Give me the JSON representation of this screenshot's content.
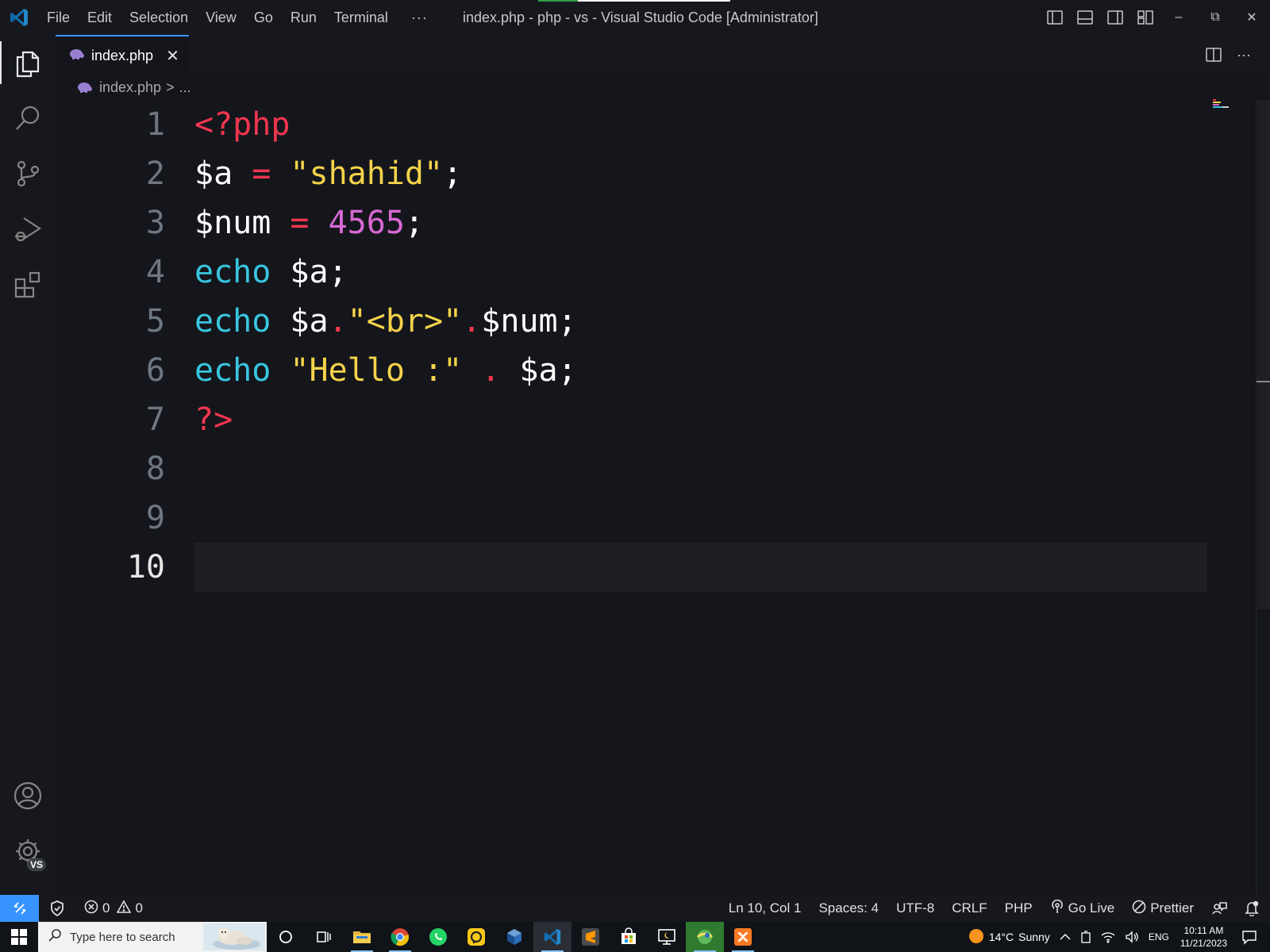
{
  "window": {
    "title": "index.php - php - vs - Visual Studio Code [Administrator]",
    "menu": [
      "File",
      "Edit",
      "Selection",
      "View",
      "Go",
      "Run",
      "Terminal"
    ],
    "menu_more": "···",
    "minimize": "–",
    "restore": "⧉",
    "close": "✕"
  },
  "activity": {
    "account_badge": "VS"
  },
  "tab": {
    "label": "index.php",
    "close": "✕",
    "more": "···"
  },
  "breadcrumb": {
    "file": "index.php",
    "separator": ">",
    "tail": "..."
  },
  "editor": {
    "current_line": 10,
    "lines": [
      {
        "number": "1"
      },
      {
        "number": "2"
      },
      {
        "number": "3"
      },
      {
        "number": "4"
      },
      {
        "number": "5"
      },
      {
        "number": "6"
      },
      {
        "number": "7"
      },
      {
        "number": "8"
      },
      {
        "number": "9"
      },
      {
        "number": "10"
      }
    ],
    "tokens": {
      "l1": [
        "<?php"
      ],
      "l2": [
        "$a",
        " = ",
        "\"shahid\"",
        ";"
      ],
      "l3": [
        "$num",
        " = ",
        "4565",
        ";"
      ],
      "l4": [
        "echo",
        " $a",
        ";"
      ],
      "l5": [
        "echo",
        " $a",
        ".",
        "\"<br>\"",
        ".",
        "$num",
        ";"
      ],
      "l6": [
        "echo",
        " \"Hello :\"",
        " . ",
        "$a",
        ";"
      ],
      "l7": [
        "?>"
      ]
    },
    "colors": {
      "tag": "#f2364f",
      "string": "#f5d34a",
      "number": "#d869d5",
      "keyword": "#39c5e0"
    }
  },
  "status": {
    "errors": "0",
    "warnings": "0",
    "position": "Ln 10, Col 1",
    "spaces": "Spaces: 4",
    "encoding": "UTF-8",
    "eol": "CRLF",
    "language": "PHP",
    "go_live": "Go Live",
    "prettier": "Prettier",
    "remote_color": "#3794ff"
  },
  "taskbar": {
    "search_placeholder": "Type here to search",
    "weather_temp": "14°C",
    "weather_text": "Sunny",
    "language": "ENG",
    "time": "10:11 AM",
    "date": "11/21/2023"
  }
}
